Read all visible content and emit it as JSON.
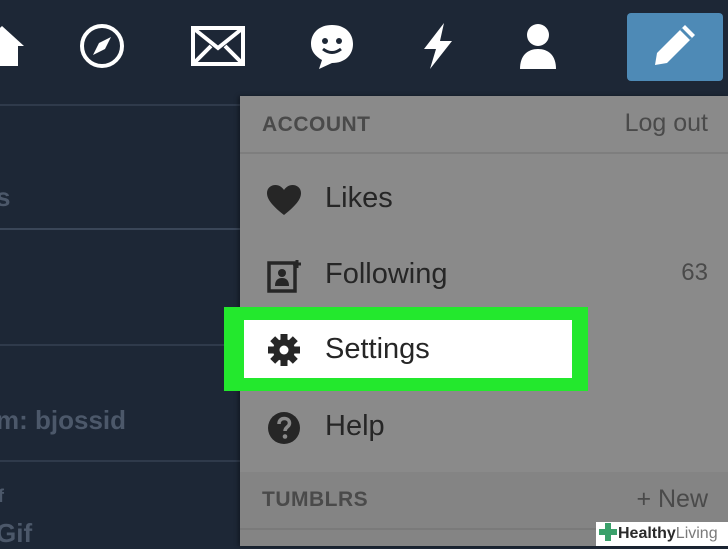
{
  "nav": {
    "icons": [
      "home-icon",
      "compass-icon",
      "mail-icon",
      "chat-icon",
      "lightning-icon",
      "account-icon",
      "compose-icon"
    ],
    "compose_color": "#4e8ab6"
  },
  "left_panel": {
    "fragment_1": "s",
    "fragment_2": "m: bjossid",
    "fragment_3": "f",
    "fragment_4": "Gif"
  },
  "account_menu": {
    "header": {
      "title": "ACCOUNT",
      "action": "Log out"
    },
    "items": [
      {
        "label": "Likes",
        "icon": "heart-icon",
        "count": ""
      },
      {
        "label": "Following",
        "icon": "following-icon",
        "count": "63"
      },
      {
        "label": "Settings",
        "icon": "gear-icon",
        "count": ""
      },
      {
        "label": "Help",
        "icon": "help-icon",
        "count": ""
      }
    ],
    "highlight_color": "#23e82d",
    "tumblrs": {
      "title": "TUMBLRS",
      "action": "+ New"
    }
  },
  "watermark": {
    "part1": "Healthy",
    "part2": "Living"
  }
}
